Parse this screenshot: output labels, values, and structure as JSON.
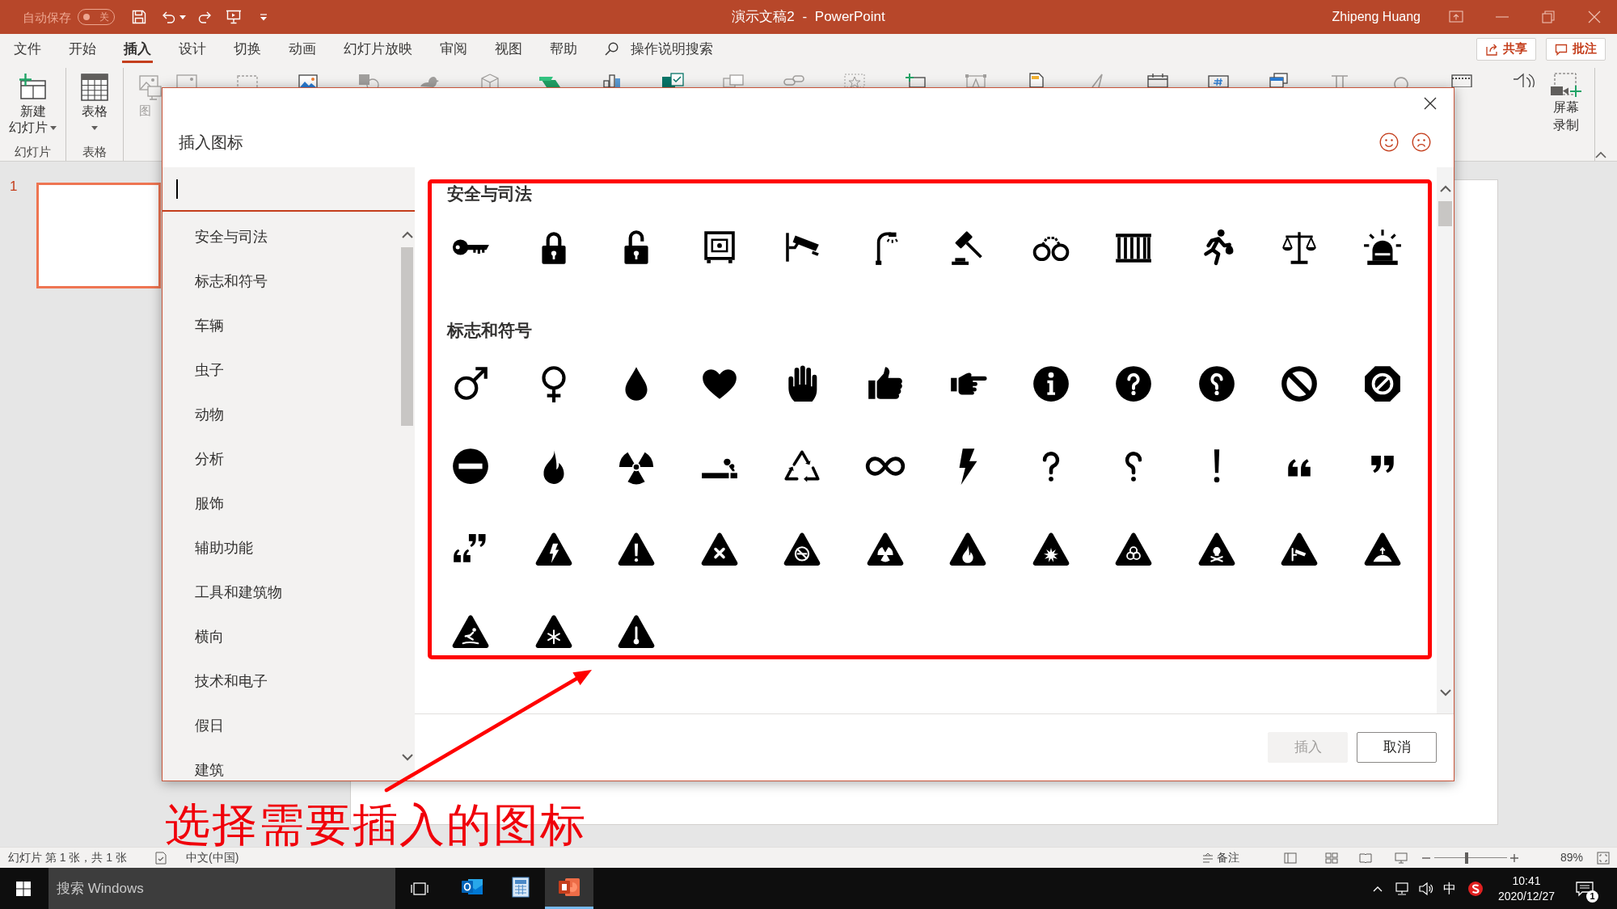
{
  "title_bar": {
    "autosave": {
      "label": "自动保存",
      "state_label": "关",
      "on": false
    },
    "document_title": "演示文稿2 - PowerPoint",
    "user": "Zhipeng Huang"
  },
  "ribbon_tabs": [
    {
      "label": "文件",
      "selected": false
    },
    {
      "label": "开始",
      "selected": false
    },
    {
      "label": "插入",
      "selected": true
    },
    {
      "label": "设计",
      "selected": false
    },
    {
      "label": "切换",
      "selected": false
    },
    {
      "label": "动画",
      "selected": false
    },
    {
      "label": "幻灯片放映",
      "selected": false
    },
    {
      "label": "审阅",
      "selected": false
    },
    {
      "label": "视图",
      "selected": false
    },
    {
      "label": "帮助",
      "selected": false
    }
  ],
  "tell_me": {
    "label": "操作说明搜索"
  },
  "share_buttons": [
    {
      "kind": "share",
      "label": "共享"
    },
    {
      "kind": "comments",
      "label": "批注"
    }
  ],
  "ribbon": {
    "groups": [
      {
        "label": "幻灯片",
        "button": {
          "kind": "new_slide",
          "lines": [
            "新建",
            "幻灯片"
          ],
          "dropdown": true
        }
      },
      {
        "label": "表格",
        "button": {
          "kind": "table",
          "lines": [
            "表格"
          ],
          "dropdown": true
        }
      }
    ],
    "partial_label": "图",
    "record_button": {
      "lines": [
        "屏幕",
        "录制"
      ]
    }
  },
  "slide_panel": {
    "slides": [
      {
        "number": "1",
        "selected": true
      }
    ]
  },
  "dialog": {
    "title": "插入图标",
    "categories": [
      {
        "label": "安全与司法",
        "selected": false
      },
      {
        "label": "标志和符号",
        "selected": false
      },
      {
        "label": "车辆",
        "selected": false
      },
      {
        "label": "虫子",
        "selected": false
      },
      {
        "label": "动物",
        "selected": false
      },
      {
        "label": "分析",
        "selected": false
      },
      {
        "label": "服饰",
        "selected": false
      },
      {
        "label": "辅助功能",
        "selected": false
      },
      {
        "label": "工具和建筑物",
        "selected": false
      },
      {
        "label": "横向",
        "selected": false
      },
      {
        "label": "技术和电子",
        "selected": false
      },
      {
        "label": "假日",
        "selected": false
      },
      {
        "label": "建筑",
        "selected": false
      }
    ],
    "sections": [
      {
        "title": "安全与司法"
      },
      {
        "title": "标志和符号"
      }
    ],
    "buttons": [
      {
        "label": "插入",
        "disabled": true
      },
      {
        "label": "取消",
        "disabled": false
      }
    ]
  },
  "annotation": {
    "caption": "选择需要插入的图标"
  },
  "status_bar": {
    "slide_info": "幻灯片 第 1 张，共 1 张",
    "language": "中文(中国)",
    "notes": "备注",
    "zoom_slider": {
      "level": 0.45
    },
    "zoom": "89%"
  },
  "taskbar": {
    "search": {
      "placeholder": "搜索 Windows"
    },
    "apps": [
      {
        "kind": "mail",
        "selected": false
      },
      {
        "kind": "grid",
        "selected": false
      },
      {
        "kind": "slides",
        "selected": true
      }
    ],
    "input_method": "中",
    "time": "10:41",
    "date": "2020/12/27",
    "notifications": "1"
  }
}
